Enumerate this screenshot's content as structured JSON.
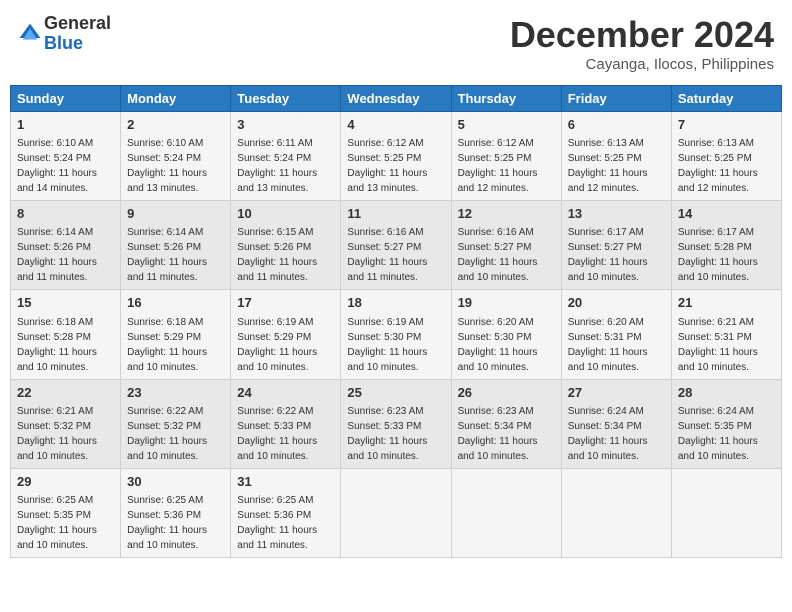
{
  "header": {
    "logo_general": "General",
    "logo_blue": "Blue",
    "month_title": "December 2024",
    "location": "Cayanga, Ilocos, Philippines"
  },
  "calendar": {
    "days_of_week": [
      "Sunday",
      "Monday",
      "Tuesday",
      "Wednesday",
      "Thursday",
      "Friday",
      "Saturday"
    ],
    "weeks": [
      [
        null,
        null,
        null,
        null,
        null,
        null,
        null
      ]
    ]
  },
  "days": {
    "1": {
      "sunrise": "6:10 AM",
      "sunset": "5:24 PM",
      "daylight": "11 hours and 14 minutes."
    },
    "2": {
      "sunrise": "6:10 AM",
      "sunset": "5:24 PM",
      "daylight": "11 hours and 13 minutes."
    },
    "3": {
      "sunrise": "6:11 AM",
      "sunset": "5:24 PM",
      "daylight": "11 hours and 13 minutes."
    },
    "4": {
      "sunrise": "6:12 AM",
      "sunset": "5:25 PM",
      "daylight": "11 hours and 13 minutes."
    },
    "5": {
      "sunrise": "6:12 AM",
      "sunset": "5:25 PM",
      "daylight": "11 hours and 12 minutes."
    },
    "6": {
      "sunrise": "6:13 AM",
      "sunset": "5:25 PM",
      "daylight": "11 hours and 12 minutes."
    },
    "7": {
      "sunrise": "6:13 AM",
      "sunset": "5:25 PM",
      "daylight": "11 hours and 12 minutes."
    },
    "8": {
      "sunrise": "6:14 AM",
      "sunset": "5:26 PM",
      "daylight": "11 hours and 11 minutes."
    },
    "9": {
      "sunrise": "6:14 AM",
      "sunset": "5:26 PM",
      "daylight": "11 hours and 11 minutes."
    },
    "10": {
      "sunrise": "6:15 AM",
      "sunset": "5:26 PM",
      "daylight": "11 hours and 11 minutes."
    },
    "11": {
      "sunrise": "6:16 AM",
      "sunset": "5:27 PM",
      "daylight": "11 hours and 11 minutes."
    },
    "12": {
      "sunrise": "6:16 AM",
      "sunset": "5:27 PM",
      "daylight": "11 hours and 10 minutes."
    },
    "13": {
      "sunrise": "6:17 AM",
      "sunset": "5:27 PM",
      "daylight": "11 hours and 10 minutes."
    },
    "14": {
      "sunrise": "6:17 AM",
      "sunset": "5:28 PM",
      "daylight": "11 hours and 10 minutes."
    },
    "15": {
      "sunrise": "6:18 AM",
      "sunset": "5:28 PM",
      "daylight": "11 hours and 10 minutes."
    },
    "16": {
      "sunrise": "6:18 AM",
      "sunset": "5:29 PM",
      "daylight": "11 hours and 10 minutes."
    },
    "17": {
      "sunrise": "6:19 AM",
      "sunset": "5:29 PM",
      "daylight": "11 hours and 10 minutes."
    },
    "18": {
      "sunrise": "6:19 AM",
      "sunset": "5:30 PM",
      "daylight": "11 hours and 10 minutes."
    },
    "19": {
      "sunrise": "6:20 AM",
      "sunset": "5:30 PM",
      "daylight": "11 hours and 10 minutes."
    },
    "20": {
      "sunrise": "6:20 AM",
      "sunset": "5:31 PM",
      "daylight": "11 hours and 10 minutes."
    },
    "21": {
      "sunrise": "6:21 AM",
      "sunset": "5:31 PM",
      "daylight": "11 hours and 10 minutes."
    },
    "22": {
      "sunrise": "6:21 AM",
      "sunset": "5:32 PM",
      "daylight": "11 hours and 10 minutes."
    },
    "23": {
      "sunrise": "6:22 AM",
      "sunset": "5:32 PM",
      "daylight": "11 hours and 10 minutes."
    },
    "24": {
      "sunrise": "6:22 AM",
      "sunset": "5:33 PM",
      "daylight": "11 hours and 10 minutes."
    },
    "25": {
      "sunrise": "6:23 AM",
      "sunset": "5:33 PM",
      "daylight": "11 hours and 10 minutes."
    },
    "26": {
      "sunrise": "6:23 AM",
      "sunset": "5:34 PM",
      "daylight": "11 hours and 10 minutes."
    },
    "27": {
      "sunrise": "6:24 AM",
      "sunset": "5:34 PM",
      "daylight": "11 hours and 10 minutes."
    },
    "28": {
      "sunrise": "6:24 AM",
      "sunset": "5:35 PM",
      "daylight": "11 hours and 10 minutes."
    },
    "29": {
      "sunrise": "6:25 AM",
      "sunset": "5:35 PM",
      "daylight": "11 hours and 10 minutes."
    },
    "30": {
      "sunrise": "6:25 AM",
      "sunset": "5:36 PM",
      "daylight": "11 hours and 10 minutes."
    },
    "31": {
      "sunrise": "6:25 AM",
      "sunset": "5:36 PM",
      "daylight": "11 hours and 11 minutes."
    }
  }
}
